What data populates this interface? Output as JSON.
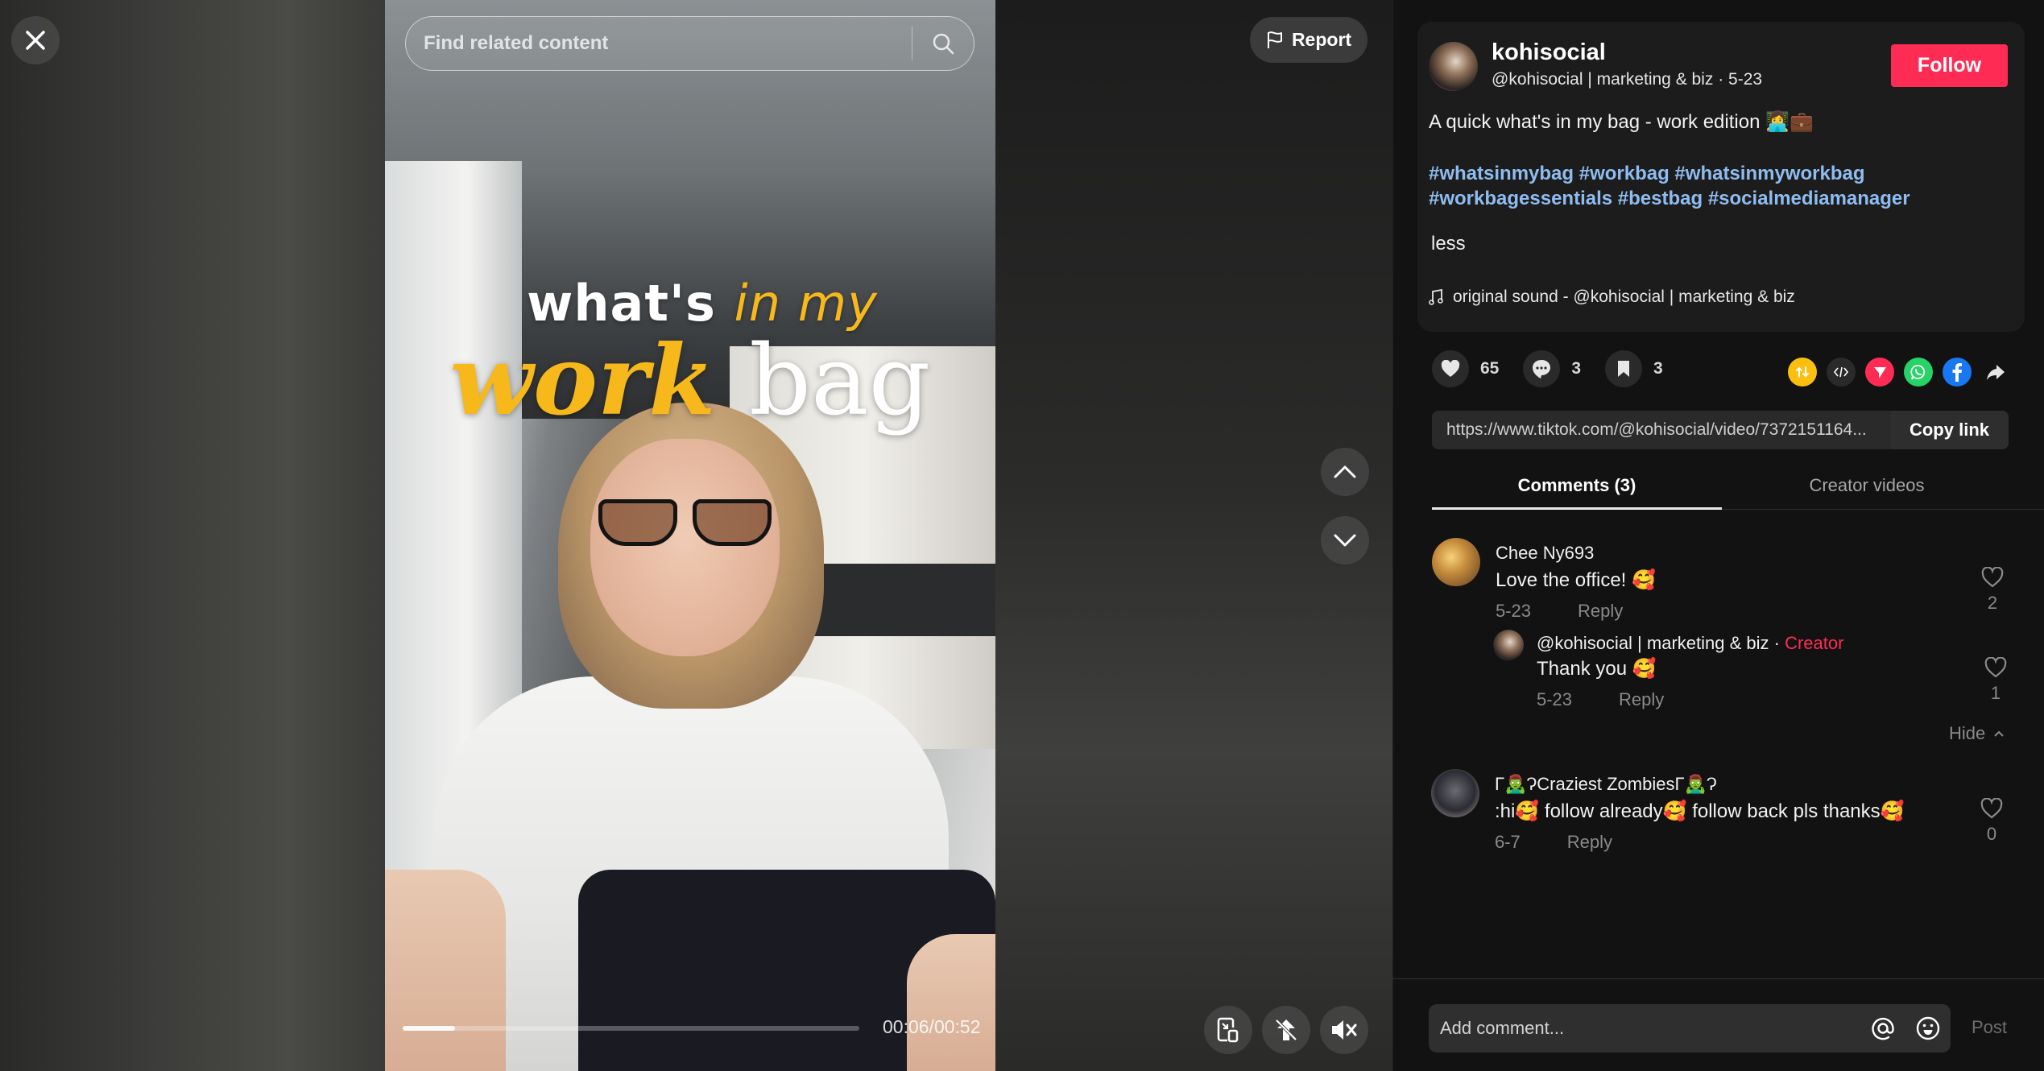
{
  "player": {
    "search_placeholder": "Find related content",
    "report_label": "Report",
    "overlay_line1_white": "what's ",
    "overlay_line1_yellow": "in my",
    "overlay_line2_yellow": "work ",
    "overlay_line2_white": "bag",
    "progress_fraction": 0.115,
    "time_current": "00:06",
    "time_total": "00:52",
    "time_display": "00:06/00:52"
  },
  "post": {
    "username": "kohisocial",
    "subtitle": "@kohisocial | marketing & biz · 5-23",
    "follow_label": "Follow",
    "description": "A quick what's in my bag - work edition 👩‍💻💼",
    "hashtags": [
      "#whatsinmybag",
      "#workbag",
      "#whatsinmyworkbag",
      "#workbagessentials",
      "#bestbag",
      "#socialmediamanager"
    ],
    "less_label": "less",
    "sound": "original sound - @kohisocial | marketing & biz"
  },
  "stats": {
    "likes": "65",
    "comments": "3",
    "saves": "3"
  },
  "share_icons": [
    "repost-icon",
    "embed-icon",
    "send-to-friends-icon",
    "whatsapp-icon",
    "facebook-icon",
    "share-arrow-icon"
  ],
  "link": {
    "url": "https://www.tiktok.com/@kohisocial/video/7372151164...",
    "copy_label": "Copy link"
  },
  "tabs": [
    {
      "label": "Comments (3)",
      "active": true
    },
    {
      "label": "Creator videos",
      "active": false
    }
  ],
  "comments": [
    {
      "author": "Chee Ny693",
      "text": "Love the office! 🥰",
      "date": "5-23",
      "reply_label": "Reply",
      "likes": "2",
      "replies": [
        {
          "author": "@kohisocial | marketing & biz",
          "badge": "Creator",
          "separator": " · ",
          "text": "Thank you 🥰",
          "date": "5-23",
          "reply_label": "Reply",
          "likes": "1"
        }
      ],
      "hide_label": "Hide"
    },
    {
      "author": "Γ🧟‍♂️ɁCraziest ZombiesΓ🧟‍♂️Ɂ",
      "text": ":hi🥰 follow already🥰 follow back pls thanks🥰",
      "date": "6-7",
      "reply_label": "Reply",
      "likes": "0"
    }
  ],
  "composer": {
    "placeholder": "Add comment...",
    "post_label": "Post"
  },
  "colors": {
    "accent": "#fe2c55",
    "hashtag": "#8fbcf0",
    "overlay_yellow": "#f6b81a"
  }
}
